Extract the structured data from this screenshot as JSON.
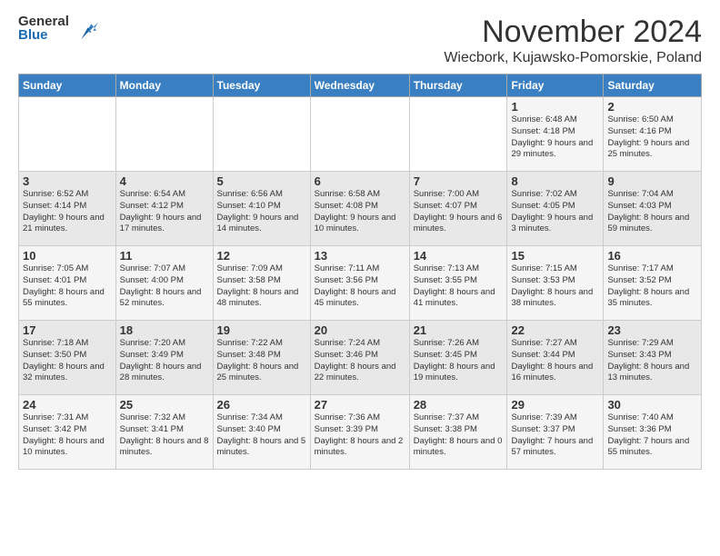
{
  "logo": {
    "general": "General",
    "blue": "Blue"
  },
  "title": "November 2024",
  "location": "Wiecbork, Kujawsko-Pomorskie, Poland",
  "days_of_week": [
    "Sunday",
    "Monday",
    "Tuesday",
    "Wednesday",
    "Thursday",
    "Friday",
    "Saturday"
  ],
  "weeks": [
    [
      {
        "day": "",
        "info": ""
      },
      {
        "day": "",
        "info": ""
      },
      {
        "day": "",
        "info": ""
      },
      {
        "day": "",
        "info": ""
      },
      {
        "day": "",
        "info": ""
      },
      {
        "day": "1",
        "info": "Sunrise: 6:48 AM\nSunset: 4:18 PM\nDaylight: 9 hours and 29 minutes."
      },
      {
        "day": "2",
        "info": "Sunrise: 6:50 AM\nSunset: 4:16 PM\nDaylight: 9 hours and 25 minutes."
      }
    ],
    [
      {
        "day": "3",
        "info": "Sunrise: 6:52 AM\nSunset: 4:14 PM\nDaylight: 9 hours and 21 minutes."
      },
      {
        "day": "4",
        "info": "Sunrise: 6:54 AM\nSunset: 4:12 PM\nDaylight: 9 hours and 17 minutes."
      },
      {
        "day": "5",
        "info": "Sunrise: 6:56 AM\nSunset: 4:10 PM\nDaylight: 9 hours and 14 minutes."
      },
      {
        "day": "6",
        "info": "Sunrise: 6:58 AM\nSunset: 4:08 PM\nDaylight: 9 hours and 10 minutes."
      },
      {
        "day": "7",
        "info": "Sunrise: 7:00 AM\nSunset: 4:07 PM\nDaylight: 9 hours and 6 minutes."
      },
      {
        "day": "8",
        "info": "Sunrise: 7:02 AM\nSunset: 4:05 PM\nDaylight: 9 hours and 3 minutes."
      },
      {
        "day": "9",
        "info": "Sunrise: 7:04 AM\nSunset: 4:03 PM\nDaylight: 8 hours and 59 minutes."
      }
    ],
    [
      {
        "day": "10",
        "info": "Sunrise: 7:05 AM\nSunset: 4:01 PM\nDaylight: 8 hours and 55 minutes."
      },
      {
        "day": "11",
        "info": "Sunrise: 7:07 AM\nSunset: 4:00 PM\nDaylight: 8 hours and 52 minutes."
      },
      {
        "day": "12",
        "info": "Sunrise: 7:09 AM\nSunset: 3:58 PM\nDaylight: 8 hours and 48 minutes."
      },
      {
        "day": "13",
        "info": "Sunrise: 7:11 AM\nSunset: 3:56 PM\nDaylight: 8 hours and 45 minutes."
      },
      {
        "day": "14",
        "info": "Sunrise: 7:13 AM\nSunset: 3:55 PM\nDaylight: 8 hours and 41 minutes."
      },
      {
        "day": "15",
        "info": "Sunrise: 7:15 AM\nSunset: 3:53 PM\nDaylight: 8 hours and 38 minutes."
      },
      {
        "day": "16",
        "info": "Sunrise: 7:17 AM\nSunset: 3:52 PM\nDaylight: 8 hours and 35 minutes."
      }
    ],
    [
      {
        "day": "17",
        "info": "Sunrise: 7:18 AM\nSunset: 3:50 PM\nDaylight: 8 hours and 32 minutes."
      },
      {
        "day": "18",
        "info": "Sunrise: 7:20 AM\nSunset: 3:49 PM\nDaylight: 8 hours and 28 minutes."
      },
      {
        "day": "19",
        "info": "Sunrise: 7:22 AM\nSunset: 3:48 PM\nDaylight: 8 hours and 25 minutes."
      },
      {
        "day": "20",
        "info": "Sunrise: 7:24 AM\nSunset: 3:46 PM\nDaylight: 8 hours and 22 minutes."
      },
      {
        "day": "21",
        "info": "Sunrise: 7:26 AM\nSunset: 3:45 PM\nDaylight: 8 hours and 19 minutes."
      },
      {
        "day": "22",
        "info": "Sunrise: 7:27 AM\nSunset: 3:44 PM\nDaylight: 8 hours and 16 minutes."
      },
      {
        "day": "23",
        "info": "Sunrise: 7:29 AM\nSunset: 3:43 PM\nDaylight: 8 hours and 13 minutes."
      }
    ],
    [
      {
        "day": "24",
        "info": "Sunrise: 7:31 AM\nSunset: 3:42 PM\nDaylight: 8 hours and 10 minutes."
      },
      {
        "day": "25",
        "info": "Sunrise: 7:32 AM\nSunset: 3:41 PM\nDaylight: 8 hours and 8 minutes."
      },
      {
        "day": "26",
        "info": "Sunrise: 7:34 AM\nSunset: 3:40 PM\nDaylight: 8 hours and 5 minutes."
      },
      {
        "day": "27",
        "info": "Sunrise: 7:36 AM\nSunset: 3:39 PM\nDaylight: 8 hours and 2 minutes."
      },
      {
        "day": "28",
        "info": "Sunrise: 7:37 AM\nSunset: 3:38 PM\nDaylight: 8 hours and 0 minutes."
      },
      {
        "day": "29",
        "info": "Sunrise: 7:39 AM\nSunset: 3:37 PM\nDaylight: 7 hours and 57 minutes."
      },
      {
        "day": "30",
        "info": "Sunrise: 7:40 AM\nSunset: 3:36 PM\nDaylight: 7 hours and 55 minutes."
      }
    ]
  ]
}
